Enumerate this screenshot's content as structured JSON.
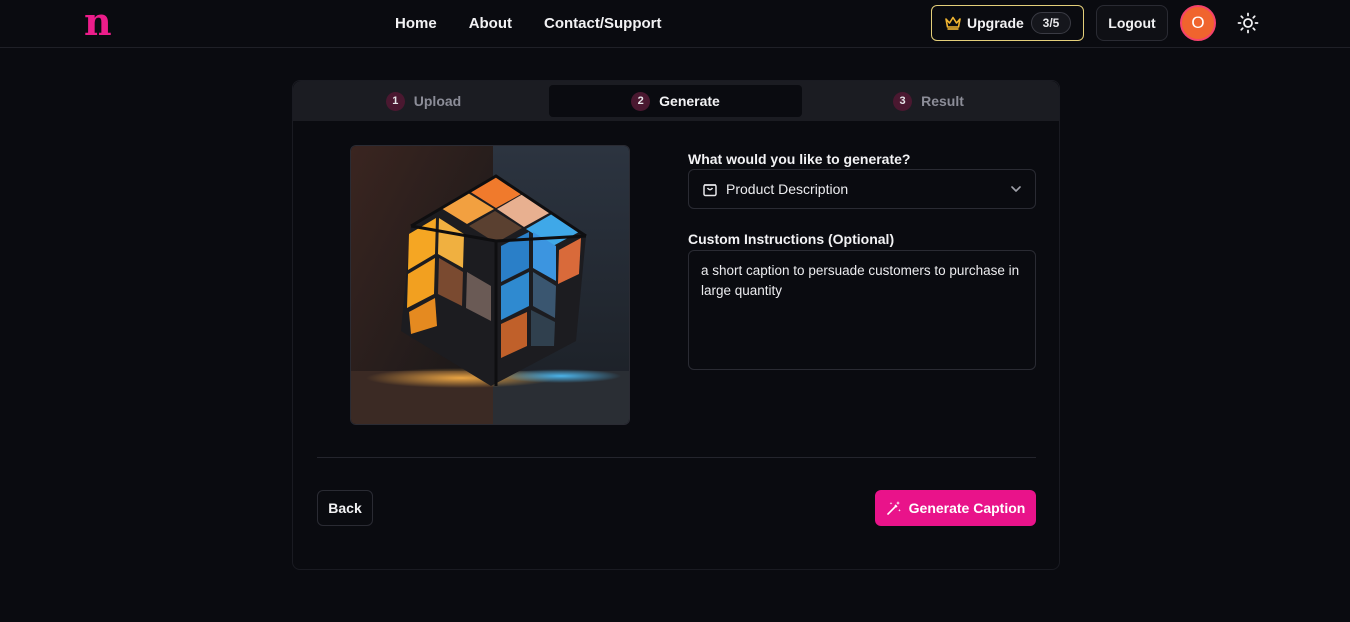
{
  "header": {
    "logo": "n",
    "nav": [
      {
        "label": "Home"
      },
      {
        "label": "About"
      },
      {
        "label": "Contact/Support"
      }
    ],
    "upgrade": {
      "label": "Upgrade",
      "count": "3/5",
      "icon": "crown-icon"
    },
    "logout_label": "Logout",
    "avatar_initial": "O",
    "theme_icon": "sun-icon"
  },
  "steps": [
    {
      "num": "1",
      "label": "Upload"
    },
    {
      "num": "2",
      "label": "Generate"
    },
    {
      "num": "3",
      "label": "Result"
    }
  ],
  "form": {
    "type_label": "What would you like to generate?",
    "type_value": "Product Description",
    "type_icon": "shopping-bag-icon",
    "instructions_label": "Custom Instructions (Optional)",
    "instructions_value": "a short caption to persuade customers to purchase in large quantity"
  },
  "actions": {
    "back_label": "Back",
    "generate_label": "Generate Caption",
    "generate_icon": "magic-wand-icon"
  },
  "colors": {
    "brand": "#ec1d8a",
    "upgrade_border": "#e4cf7a",
    "avatar": "#f0642e",
    "background": "#0a0b10"
  }
}
